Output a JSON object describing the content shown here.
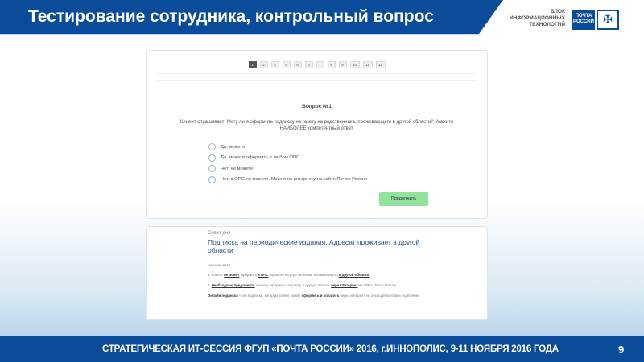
{
  "header": {
    "title": "Тестирование сотрудника, контрольный вопрос",
    "block_lines": [
      "БЛОК",
      "ИНФОРМАЦИОННЫХ",
      "ТЕХНОЛОГИЙ"
    ],
    "logo_text": [
      "ПОЧТА",
      "РОССИИ"
    ],
    "brand_color": "#0a4b9a"
  },
  "test": {
    "pages": [
      "1",
      "2",
      "3",
      "4",
      "5",
      "6",
      "7",
      "8",
      "9",
      "10",
      "11",
      "12"
    ],
    "active_page": "1",
    "question_title": "Вопрос №1",
    "question_text": "Клиент спрашивает: Могу ли я оформить подписку на газету на родственника, проживающего в другой области? Укажите НАИБОЛЕЕ компетентный ответ.",
    "options": [
      "Да, можете",
      "Да, можете оформить в любом ОПС",
      "Нет, не можете",
      "Нет, в ОПС не можете. Можно по интернету на сайте Почты России"
    ],
    "continue_label": "Продолжить"
  },
  "tip": {
    "label": "Совет дня",
    "title": "Подписка на периодические издания. Адресат проживает в другой области",
    "reminder": "Напоминаем!",
    "p1": [
      "1. Клиент ",
      "не может",
      " оформить ",
      "в ОПС",
      " подписку на родственника, проживающего ",
      "в другой области."
    ],
    "p2": [
      "2. ",
      "Необходимо предложить",
      " клиенту оформить подписку в другую область ",
      "через Интернет",
      " на сайте Почты России."
    ],
    "p3": [
      "Онлайн подписка",
      " – это подписка, которую клиент может ",
      "оформить и оплатить",
      " через интернет, не посещая почтовое отделение."
    ]
  },
  "footer": {
    "text": "СТРАТЕГИЧЕСКАЯ ИТ-СЕССИЯ ФГУП «ПОЧТА РОССИИ» 2016, г.ИННОПОЛИС, 9-11 НОЯБРЯ 2016 ГОДА",
    "slide_number": "9"
  }
}
